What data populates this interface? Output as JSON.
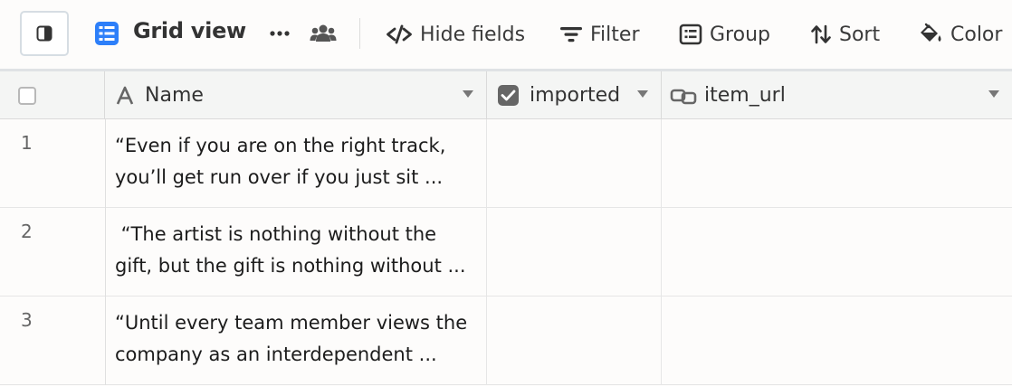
{
  "toolbar": {
    "view_name": "Grid view",
    "hide_fields_label": "Hide fields",
    "filter_label": "Filter",
    "group_label": "Group",
    "sort_label": "Sort",
    "color_label": "Color",
    "icons": {
      "sidebar_toggle": "sidebar-toggle-icon",
      "view": "grid-view-icon",
      "more": "more-horizontal-icon",
      "collaborators": "people-icon",
      "hide_fields": "eye-slash-icon",
      "filter": "filter-icon",
      "group": "group-icon",
      "sort": "sort-icon",
      "color": "paint-bucket-icon"
    },
    "accent_color": "#2d7ff9"
  },
  "grid": {
    "columns": [
      {
        "label": "Name",
        "icon": "text-field-icon"
      },
      {
        "label": "imported",
        "icon": "checkbox-field-icon"
      },
      {
        "label": "item_url",
        "icon": "link-field-icon"
      }
    ],
    "rows": [
      {
        "number": "1",
        "name": "“Even if you are on the right track,\nyou’ll get run over if you just sit ...",
        "imported": "",
        "item_url": ""
      },
      {
        "number": "2",
        "name": " “The artist is nothing without the\ngift, but the gift is nothing without ...",
        "imported": "",
        "item_url": ""
      },
      {
        "number": "3",
        "name": "“Until every team member views the\ncompany as an interdependent ...",
        "imported": "",
        "item_url": ""
      }
    ]
  }
}
